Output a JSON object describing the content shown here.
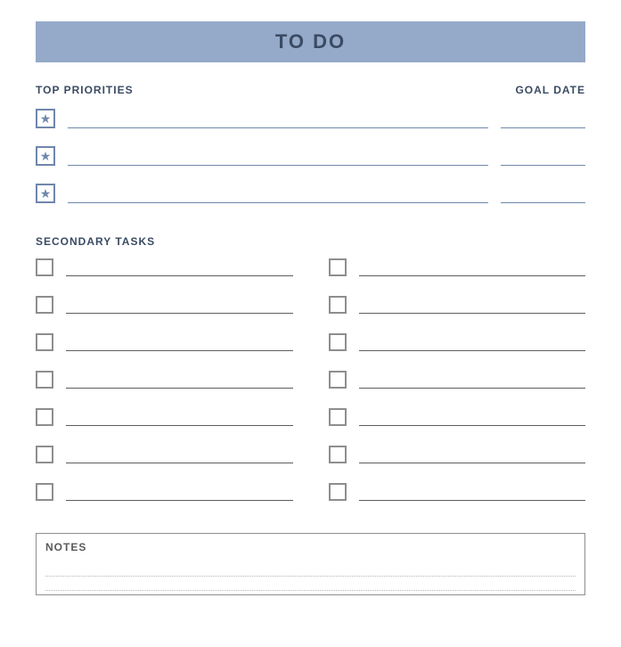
{
  "title": "TO DO",
  "headers": {
    "top_priorities": "TOP PRIORITIES",
    "goal_date": "GOAL DATE",
    "secondary_tasks": "SECONDARY TASKS",
    "notes": "NOTES"
  },
  "priorities": [
    {
      "star": "★",
      "text": "",
      "goal_date": ""
    },
    {
      "star": "★",
      "text": "",
      "goal_date": ""
    },
    {
      "star": "★",
      "text": "",
      "goal_date": ""
    }
  ],
  "secondary_tasks_left": [
    {
      "text": ""
    },
    {
      "text": ""
    },
    {
      "text": ""
    },
    {
      "text": ""
    },
    {
      "text": ""
    },
    {
      "text": ""
    },
    {
      "text": ""
    }
  ],
  "secondary_tasks_right": [
    {
      "text": ""
    },
    {
      "text": ""
    },
    {
      "text": ""
    },
    {
      "text": ""
    },
    {
      "text": ""
    },
    {
      "text": ""
    },
    {
      "text": ""
    }
  ],
  "notes_lines": [
    "",
    ""
  ]
}
